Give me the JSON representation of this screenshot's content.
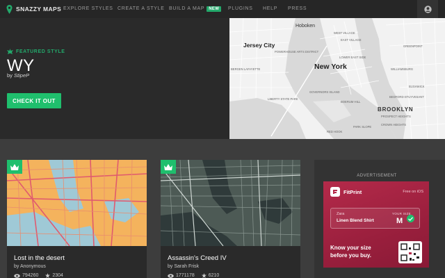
{
  "brand": {
    "name": "SNAZZY MAPS"
  },
  "nav": {
    "items": [
      "EXPLORE STYLES",
      "CREATE A STYLE",
      "BUILD A MAP",
      "PLUGINS",
      "HELP",
      "PRESS"
    ],
    "new_badge": "NEW",
    "accent": "#23a96b"
  },
  "hero": {
    "featured_label": "FEATURED STYLE",
    "title": "WY",
    "by_prefix": "by",
    "author": "StipeP",
    "cta": "CHECK IT OUT",
    "map_labels": {
      "hoboken": "Hoboken",
      "jersey_city": "Jersey City",
      "new_york": "New York",
      "brooklyn": "BROOKLYN",
      "small": [
        "WEST VILLAGE",
        "EAST VILLAGE",
        "LOWER EAST SIDE",
        "GREENPOINT",
        "WILLIAMSBURG",
        "BUSHWICK",
        "PARK SLOPE",
        "PROSPECT HEIGHTS",
        "BEDFORD-STUYVESANT",
        "CROWN HEIGHTS",
        "BOERUM HILL",
        "RED HOOK",
        "LIBERTY STATE PARK",
        "GOVERNORS ISLAND",
        "BERGEN LAFAYETTE",
        "POWERHOUSE ARTS DISTRICT"
      ]
    }
  },
  "cards": [
    {
      "title": "Lost in the desert",
      "author": "by Anonymous",
      "views": "794260",
      "stars": "2304",
      "crown_icon": "crown-icon"
    },
    {
      "title": "Assassin's Creed IV",
      "author": "by Sarah Frisk",
      "views": "1771178",
      "stars": "6210",
      "crown_icon": "crown-icon"
    }
  ],
  "ad": {
    "label": "ADVERTISEMENT",
    "brand": "FitPrint",
    "free_text": "Free on iOS",
    "store": "Zara",
    "product": "Linen Blend Shirt",
    "size_label": "YOUR SIZE",
    "size": "M",
    "headline_1": "Know your size",
    "headline_2": "before you buy."
  }
}
